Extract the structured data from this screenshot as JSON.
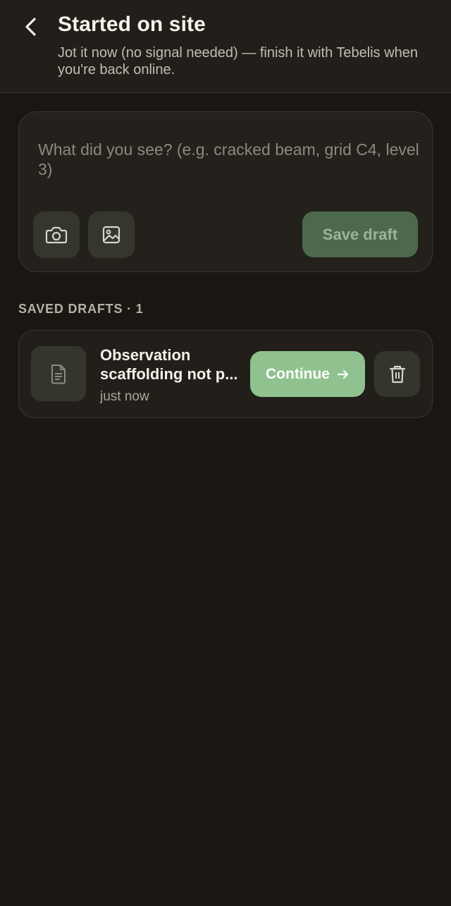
{
  "header": {
    "title": "Started on site",
    "subtitle": "Jot it now (no signal needed) — finish it with Tebelis when you're back online.",
    "back_icon": "chevron-left-icon"
  },
  "composer": {
    "placeholder": "What did you see? (e.g. cracked beam, grid C4, level 3)",
    "value": "",
    "camera_icon": "camera-icon",
    "gallery_icon": "image-icon",
    "save_label": "Save draft"
  },
  "drafts": {
    "heading": "SAVED DRAFTS · 1",
    "items": [
      {
        "title_line1": "Observation",
        "title_line2": "scaffolding not p...",
        "time": "just now",
        "icon": "document-icon",
        "continue_label": "Continue",
        "delete_icon": "trash-icon"
      }
    ]
  },
  "colors": {
    "background": "#1a1712",
    "accent": "#8fc28e",
    "save_disabled": "#4c6a4b"
  }
}
